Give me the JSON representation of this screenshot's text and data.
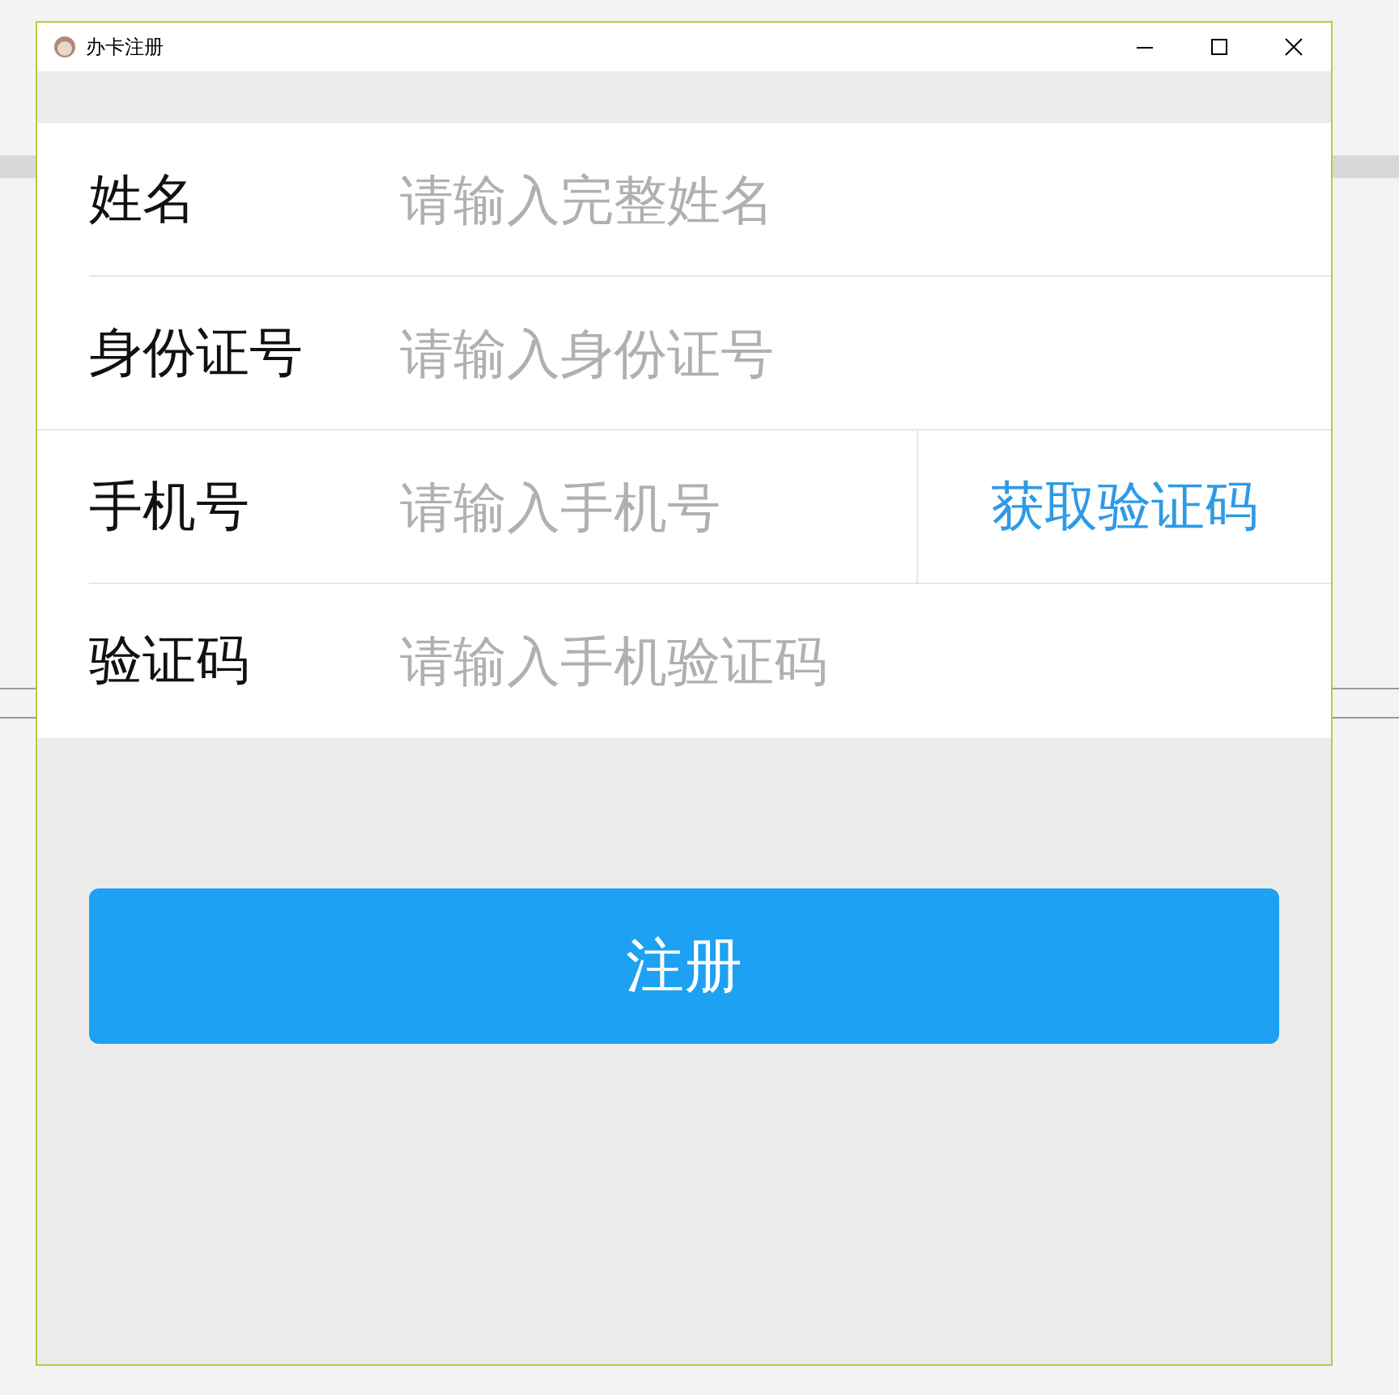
{
  "window": {
    "title": "办卡注册"
  },
  "fields": [
    {
      "label": "姓名",
      "placeholder": "请输入完整姓名"
    },
    {
      "label": "身份证号",
      "placeholder": "请输入身份证号"
    },
    {
      "label": "手机号",
      "placeholder": "请输入手机号",
      "action": "获取验证码"
    },
    {
      "label": "验证码",
      "placeholder": "请输入手机验证码"
    }
  ],
  "submit": "注册"
}
